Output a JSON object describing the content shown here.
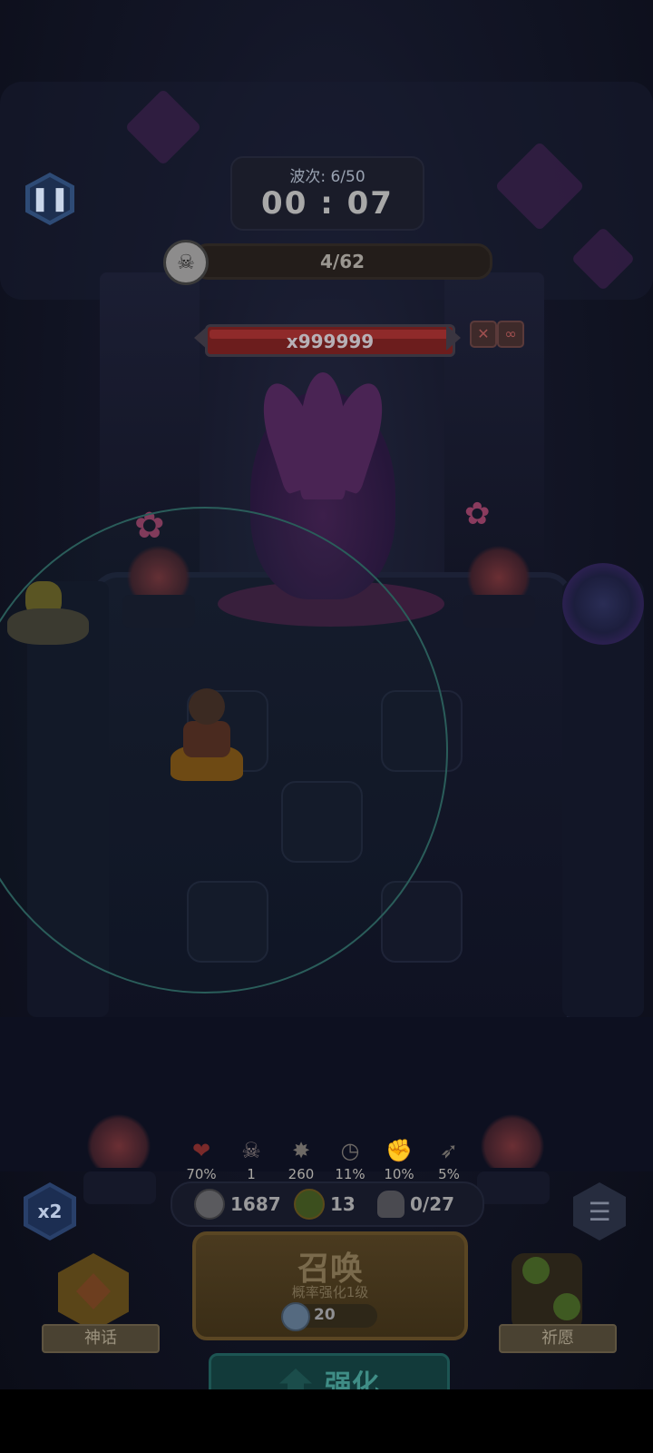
{
  "hud": {
    "wave_label": "波次: 6/50",
    "timer": "00 : 07",
    "kill_progress": "4/62",
    "boss_hp": "x999999"
  },
  "stats": [
    {
      "icon": "heart-icon",
      "value": "70%",
      "color": "#7a2a2a"
    },
    {
      "icon": "devil-skull-icon",
      "value": "1",
      "color": "#7a7070"
    },
    {
      "icon": "burst-icon",
      "value": "260",
      "color": "#6e6a66"
    },
    {
      "icon": "clock-icon",
      "value": "11%",
      "color": "#6e6a66"
    },
    {
      "icon": "fist-icon",
      "value": "10%",
      "color": "#6e6a66"
    },
    {
      "icon": "wing-icon",
      "value": "5%",
      "color": "#6e6a66"
    }
  ],
  "resources": {
    "silver": "1687",
    "clover": "13",
    "units": "0/27"
  },
  "buttons": {
    "speed": "x2",
    "summon_title": "召唤",
    "summon_sub": "概率强化1级",
    "summon_cost": "20",
    "myth": "神话",
    "wish": "祈愿",
    "strengthen": "强化"
  },
  "colors": {
    "range_circle": "#2a5d5a",
    "summon_gold": "#4a3a1f",
    "strengthen_teal": "#123a3a"
  }
}
